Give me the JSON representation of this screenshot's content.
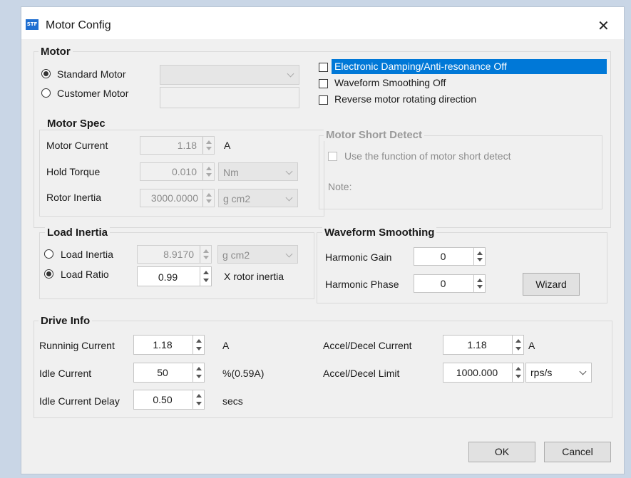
{
  "window": {
    "title": "Motor Config",
    "logo_text": "STF",
    "close_glyph": "✕"
  },
  "motor": {
    "group_title": "Motor",
    "standard_motor_label": "Standard Motor",
    "customer_motor_label": "Customer Motor",
    "standard_motor_selected": true,
    "standard_motor_value": "",
    "customer_motor_value": "",
    "options": [
      {
        "label": "Electronic Damping/Anti-resonance Off",
        "checked": false,
        "highlighted": true
      },
      {
        "label": "Waveform Smoothing Off",
        "checked": false
      },
      {
        "label": "Reverse motor rotating direction",
        "checked": false
      }
    ]
  },
  "motor_spec": {
    "group_title": "Motor Spec",
    "current_label": "Motor Current",
    "current_value": "1.18",
    "current_unit": "A",
    "hold_torque_label": "Hold Torque",
    "hold_torque_value": "0.010",
    "hold_torque_unit": "Nm",
    "rotor_inertia_label": "Rotor Inertia",
    "rotor_inertia_value": "3000.0000",
    "rotor_inertia_unit": "g cm2"
  },
  "short_detect": {
    "group_title": "Motor Short Detect",
    "use_label": "Use the function of motor short detect",
    "note_label": "Note:"
  },
  "load_inertia": {
    "group_title": "Load Inertia",
    "inertia_label": "Load Inertia",
    "inertia_value": "8.9170",
    "inertia_unit": "g cm2",
    "ratio_label": "Load Ratio",
    "ratio_value": "0.99",
    "ratio_unit": "X rotor inertia",
    "ratio_selected": true
  },
  "waveform": {
    "group_title": "Waveform Smoothing",
    "gain_label": "Harmonic Gain",
    "gain_value": "0",
    "phase_label": "Harmonic Phase",
    "phase_value": "0",
    "wizard_label": "Wizard"
  },
  "drive_info": {
    "group_title": "Drive Info",
    "running_label": "Runninig Current",
    "running_value": "1.18",
    "running_unit": "A",
    "idle_label": "Idle Current",
    "idle_value": "50",
    "idle_unit": "%(0.59A)",
    "delay_label": "Idle Current Delay",
    "delay_value": "0.50",
    "delay_unit": "secs",
    "accel_current_label": "Accel/Decel Current",
    "accel_current_value": "1.18",
    "accel_current_unit": "A",
    "accel_limit_label": "Accel/Decel Limit",
    "accel_limit_value": "1000.000",
    "accel_limit_unit": "rps/s"
  },
  "footer": {
    "ok_label": "OK",
    "cancel_label": "Cancel"
  },
  "colors": {
    "highlight": "#0078d7",
    "dialog_bg": "#f0f0f0",
    "outer_bg": "#c9d6e6"
  }
}
